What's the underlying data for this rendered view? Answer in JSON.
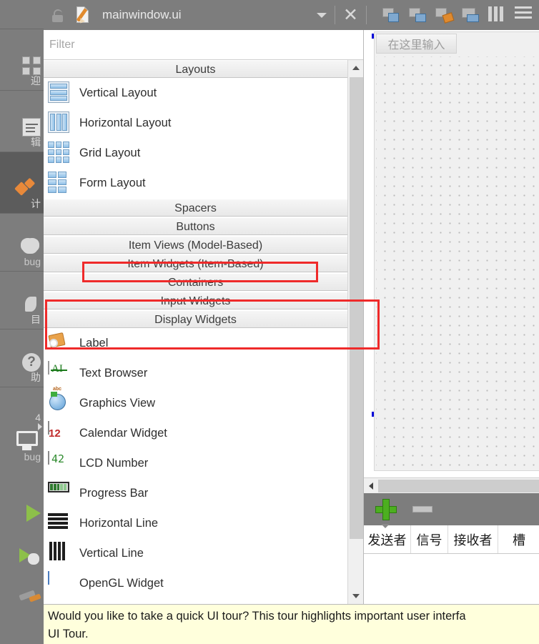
{
  "modebar": {
    "items": [
      {
        "label": "迎",
        "icon": "grid-welcome-icon",
        "active": false
      },
      {
        "label": "辑",
        "icon": "edit-document-icon",
        "active": false
      },
      {
        "label": "计",
        "icon": "design-icon",
        "active": true
      },
      {
        "label": "bug",
        "icon": "debug-bug-icon",
        "active": false
      },
      {
        "label": "目",
        "icon": "projects-wrench-icon",
        "active": false
      },
      {
        "label": "助",
        "icon": "help-question-icon",
        "active": false
      }
    ],
    "kit": {
      "number": "4",
      "icon": "desktop-kit-icon",
      "label": "bug",
      "arrow": "chevron-right-icon"
    },
    "run_buttons": [
      {
        "icon": "run-play-icon"
      },
      {
        "icon": "run-debug-icon"
      },
      {
        "icon": "build-hammer-icon"
      }
    ]
  },
  "titlebar": {
    "lock_icon": "unlock-icon",
    "file_icon": "ui-file-edit-icon",
    "filename": "mainwindow.ui",
    "dropdown_icon": "chevron-down-icon",
    "close_label": "✕",
    "tools": [
      {
        "icon": "edit-widgets-icon"
      },
      {
        "icon": "edit-signals-slots-icon"
      },
      {
        "icon": "edit-buddies-icon"
      },
      {
        "icon": "edit-tab-order-icon"
      },
      {
        "icon": "vertical-splitter-icon"
      },
      {
        "icon": "menu-hamburger-icon"
      }
    ]
  },
  "filter": {
    "placeholder": "Filter",
    "value": ""
  },
  "widgetbox": {
    "scrollbar": {
      "up_icon": "chevron-up-icon",
      "down_icon": "chevron-down-icon"
    },
    "groups": [
      {
        "name": "Layouts",
        "expanded": true,
        "items": [
          {
            "label": "Vertical Layout",
            "icon": "vertical-layout-icon"
          },
          {
            "label": "Horizontal Layout",
            "icon": "horizontal-layout-icon"
          },
          {
            "label": "Grid Layout",
            "icon": "grid-layout-icon"
          },
          {
            "label": "Form Layout",
            "icon": "form-layout-icon"
          }
        ]
      },
      {
        "name": "Spacers",
        "expanded": false,
        "items": []
      },
      {
        "name": "Buttons",
        "expanded": false,
        "items": []
      },
      {
        "name": "Item Views (Model-Based)",
        "expanded": false,
        "items": []
      },
      {
        "name": "Item Widgets (Item-Based)",
        "expanded": false,
        "items": []
      },
      {
        "name": "Containers",
        "expanded": false,
        "items": []
      },
      {
        "name": "Input Widgets",
        "expanded": false,
        "items": []
      },
      {
        "name": "Display Widgets",
        "expanded": true,
        "items": [
          {
            "label": "Label",
            "icon": "label-icon"
          },
          {
            "label": "Text Browser",
            "icon": "text-browser-icon"
          },
          {
            "label": "Graphics View",
            "icon": "graphics-view-icon"
          },
          {
            "label": "Calendar Widget",
            "icon": "calendar-widget-icon"
          },
          {
            "label": "LCD Number",
            "icon": "lcd-number-icon"
          },
          {
            "label": "Progress Bar",
            "icon": "progress-bar-icon"
          },
          {
            "label": "Horizontal Line",
            "icon": "horizontal-line-icon"
          },
          {
            "label": "Vertical Line",
            "icon": "vertical-line-icon"
          },
          {
            "label": "OpenGL Widget",
            "icon": "opengl-widget-icon"
          }
        ]
      }
    ]
  },
  "form": {
    "menubar_placeholder": "在这里输入",
    "hscroll_left_icon": "chevron-left-icon"
  },
  "signal_slot_editor": {
    "add_icon": "add-plus-icon",
    "remove_icon": "remove-minus-icon",
    "columns": [
      "发送者",
      "信号",
      "接收者",
      "槽"
    ]
  },
  "notification": {
    "line1": "Would you like to take a quick UI tour? This tour highlights important user interfa",
    "line2": "UI Tour."
  },
  "annotations": {
    "boxes": [
      {
        "name": "item-widgets-highlight",
        "color": "#ef2a2a"
      },
      {
        "name": "input-display-widgets-highlight",
        "color": "#ef2a2a"
      }
    ]
  },
  "colors": {
    "chrome_gray": "#7d7d7d",
    "accent_red": "#ef2a2a",
    "notify_yellow": "#ffffdc",
    "selection_blue": "#0000d8"
  }
}
